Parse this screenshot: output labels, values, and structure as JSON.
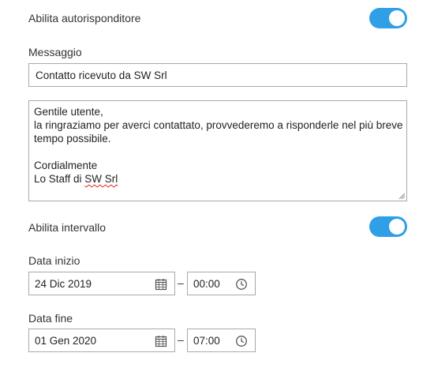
{
  "autoresponder": {
    "label": "Abilita autorisponditore",
    "enabled": true
  },
  "message": {
    "label": "Messaggio",
    "subject": "Contatto ricevuto da SW Srl",
    "body_lines": [
      "Gentile utente,",
      "la ringraziamo per averci contattato, provvederemo a risponderle nel più breve",
      "tempo possibile.",
      "",
      "Cordialmente"
    ],
    "signature_prefix": "Lo Staff di ",
    "signature_company": "SW Srl"
  },
  "interval": {
    "label": "Abilita intervallo",
    "enabled": true
  },
  "start": {
    "label": "Data inizio",
    "date": "24 Dic 2019",
    "separator": "–",
    "time": "00:00"
  },
  "end": {
    "label": "Data fine",
    "date": "01 Gen 2020",
    "separator": "–",
    "time": "07:00"
  },
  "icons": {
    "calendar": "calendar-icon",
    "clock": "clock-icon"
  },
  "colors": {
    "toggle_on": "#2f9fe6",
    "border": "#a9a9a9",
    "spellcheck": "#e02020"
  }
}
